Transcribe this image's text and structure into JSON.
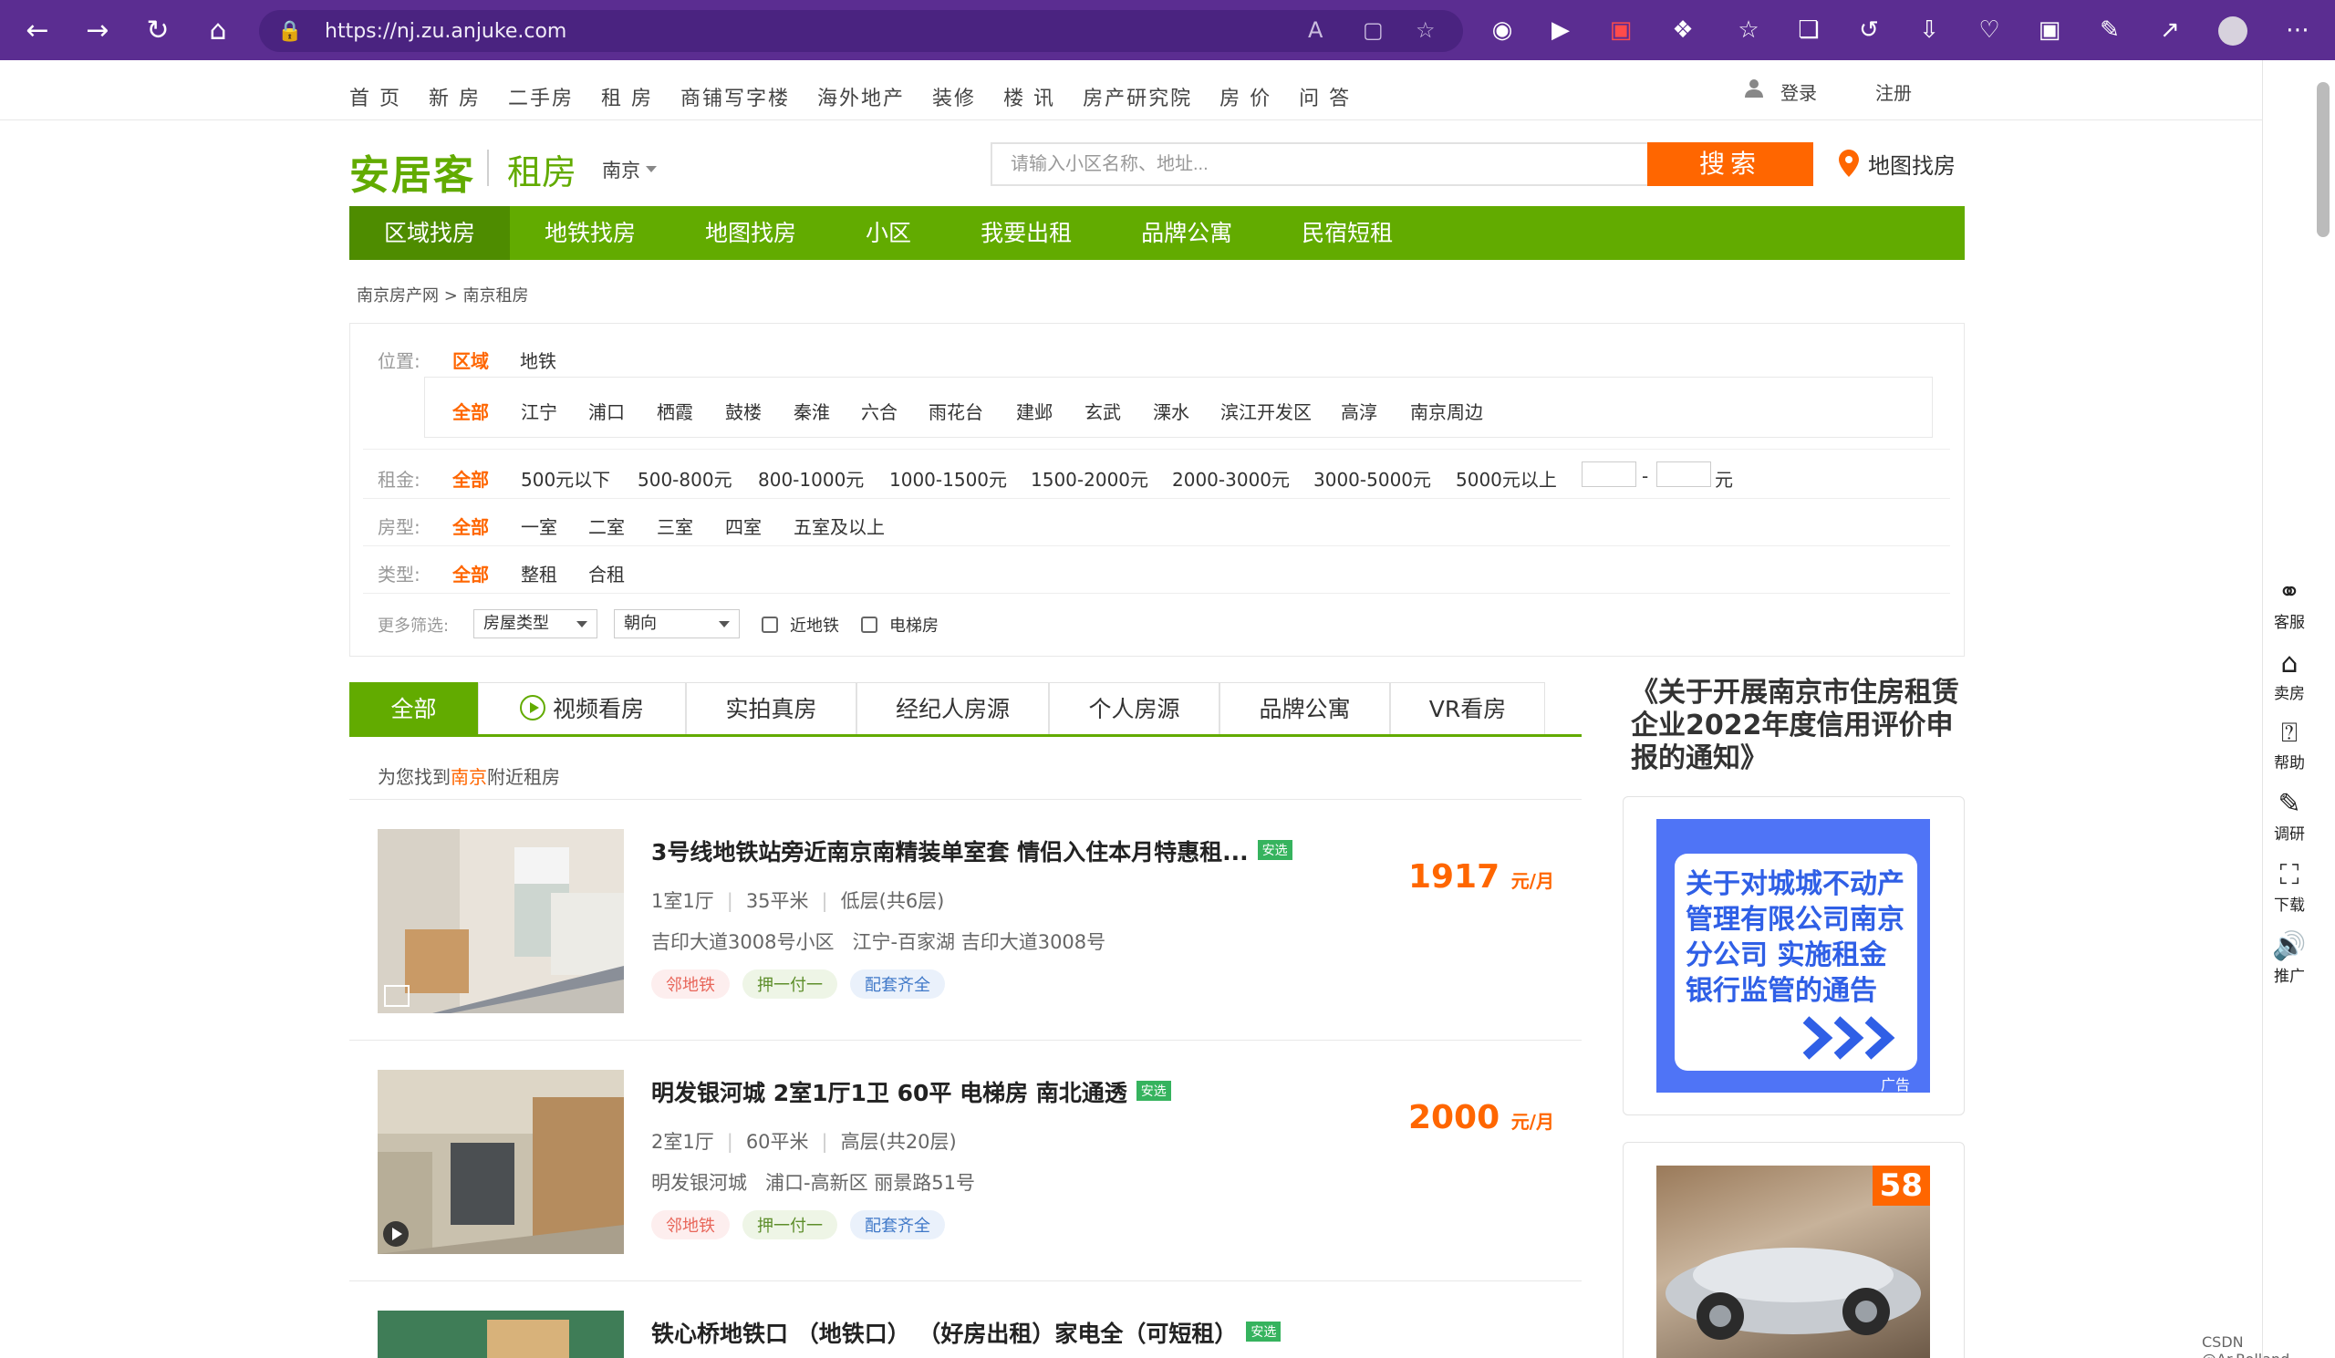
{
  "browser": {
    "url": "https://nj.zu.anjuke.com"
  },
  "topnav": [
    "首 页",
    "新 房",
    "二手房",
    "租 房",
    "商铺写字楼",
    "海外地产",
    "装修",
    "楼 讯",
    "房产研究院",
    "房 价",
    "问 答"
  ],
  "auth": {
    "login": "登录",
    "register": "注册"
  },
  "header": {
    "logo": "安居客",
    "section": "租房",
    "city": "南京",
    "search_placeholder": "请输入小区名称、地址...",
    "search_button": "搜索",
    "map_find": "地图找房"
  },
  "greennav": [
    "区域找房",
    "地铁找房",
    "地图找房",
    "小区",
    "我要出租",
    "品牌公寓",
    "民宿短租"
  ],
  "breadcrumb": "南京房产网 > 南京租房",
  "filters": {
    "position": {
      "label": "位置:",
      "options": [
        "区域",
        "地铁"
      ]
    },
    "districts": [
      "全部",
      "江宁",
      "浦口",
      "栖霞",
      "鼓楼",
      "秦淮",
      "六合",
      "雨花台",
      "建邺",
      "玄武",
      "溧水",
      "滨江开发区",
      "高淳",
      "南京周边"
    ],
    "rent": {
      "label": "租金:",
      "options": [
        "全部",
        "500元以下",
        "500-800元",
        "800-1000元",
        "1000-1500元",
        "1500-2000元",
        "2000-3000元",
        "3000-5000元",
        "5000元以上"
      ],
      "dash": "-",
      "unit": "元"
    },
    "layout": {
      "label": "房型:",
      "options": [
        "全部",
        "一室",
        "二室",
        "三室",
        "四室",
        "五室及以上"
      ]
    },
    "type": {
      "label": "类型:",
      "options": [
        "全部",
        "整租",
        "合租"
      ]
    },
    "more": {
      "label": "更多筛选:",
      "house_type": "房屋类型",
      "orientation": "朝向",
      "near_subway": "近地铁",
      "elevator": "电梯房"
    }
  },
  "tabs": [
    "全部",
    "视频看房",
    "实拍真房",
    "经纪人房源",
    "个人房源",
    "品牌公寓",
    "VR看房"
  ],
  "found": {
    "prefix": "为您找到",
    "city": "南京",
    "suffix": "附近租房"
  },
  "listings": [
    {
      "title": "3号线地铁站旁近南京南精装单室套 情侣入住本月特惠租...",
      "badge": "安选",
      "rooms": "1室1厅",
      "area": "35平米",
      "floor": "低层(共6层)",
      "community": "吉印大道3008号小区",
      "location": "江宁-百家湖 吉印大道3008号",
      "tags": [
        "邻地铁",
        "押一付一",
        "配套齐全"
      ],
      "price": "1917",
      "price_unit": "元/月"
    },
    {
      "title": "明发银河城 2室1厅1卫 60平 电梯房 南北通透",
      "badge": "安选",
      "rooms": "2室1厅",
      "area": "60平米",
      "floor": "高层(共20层)",
      "community": "明发银河城",
      "location": "浦口-高新区 丽景路51号",
      "tags": [
        "邻地铁",
        "押一付一",
        "配套齐全"
      ],
      "price": "2000",
      "price_unit": "元/月"
    },
    {
      "title": "铁心桥地铁口 （地铁口） （好房出租）家电全（可短租）",
      "badge": "安选"
    }
  ],
  "sidebar": {
    "notice": "《关于开展南京市住房租赁企业2022年度信用评价申报的通知》",
    "ad_text": "关于对城城不动产管理有限公司南京分公司 实施租金银行监管的通告",
    "ad_label": "广告",
    "ad2_badge": "58"
  },
  "sidepanel": [
    {
      "label": "客服",
      "icon": "headset-icon"
    },
    {
      "label": "卖房",
      "icon": "home-icon"
    },
    {
      "label": "帮助",
      "icon": "help-icon"
    },
    {
      "label": "调研",
      "icon": "survey-icon"
    },
    {
      "label": "下载",
      "icon": "download-icon"
    },
    {
      "label": "推广",
      "icon": "megaphone-icon"
    }
  ],
  "watermark": "CSDN @Ar.Rolland"
}
